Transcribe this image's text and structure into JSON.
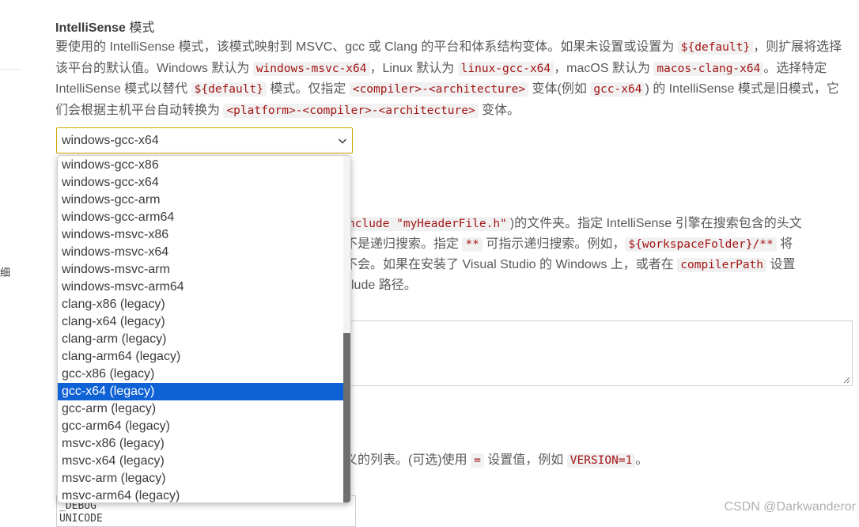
{
  "setting": {
    "title": "IntelliSense",
    "title_suffix": " 模式",
    "description": [
      {
        "t": "要使用的 IntelliSense 模式，该模式映射到 MSVC、gcc 或 Clang 的平台和体系结构变体。如果未设置或设置为 "
      },
      {
        "c": "${default}"
      },
      {
        "t": "，则扩展将选择该平台的默认值。Windows 默认为 "
      },
      {
        "c": "windows-msvc-x64"
      },
      {
        "t": "，Linux 默认为 "
      },
      {
        "c": "linux-gcc-x64"
      },
      {
        "t": "，macOS 默认为 "
      },
      {
        "c": "macos-clang-x64"
      },
      {
        "t": "。选择特定 IntelliSense 模式以替代 "
      },
      {
        "c": "${default}"
      },
      {
        "t": " 模式。仅指定 "
      },
      {
        "c": "<compiler>-<architecture>"
      },
      {
        "t": " 变体(例如 "
      },
      {
        "c": "gcc-x64"
      },
      {
        "t": ") 的 IntelliSense 模式是旧模式，它们会根据主机平台自动转换为 "
      },
      {
        "c": "<platform>-<compiler>-<architecture>"
      },
      {
        "t": " 变体。"
      }
    ]
  },
  "select": {
    "value": "windows-gcc-x64",
    "options": [
      "windows-gcc-x86",
      "windows-gcc-x64",
      "windows-gcc-arm",
      "windows-gcc-arm64",
      "windows-msvc-x86",
      "windows-msvc-x64",
      "windows-msvc-arm",
      "windows-msvc-arm64",
      "clang-x86 (legacy)",
      "clang-x64 (legacy)",
      "clang-arm (legacy)",
      "clang-arm64 (legacy)",
      "gcc-x86 (legacy)",
      "gcc-x64 (legacy)",
      "gcc-arm (legacy)",
      "gcc-arm64 (legacy)",
      "msvc-x86 (legacy)",
      "msvc-x64 (legacy)",
      "msvc-arm (legacy)",
      "msvc-arm64 (legacy)"
    ],
    "highlighted_index": 13
  },
  "include_path": {
    "line1": [
      {
        "c": "nclude \"myHeaderFile.h\""
      },
      {
        "t": ")的文件夹。指定 IntelliSense 引擎在搜索包含的头文"
      }
    ],
    "line2": [
      {
        "t": "不是递归搜索。指定 "
      },
      {
        "c": "**"
      },
      {
        "t": " 可指示递归搜索。例如，"
      },
      {
        "c": "${workspaceFolder}/**"
      },
      {
        "t": " 将"
      }
    ],
    "line3": [
      {
        "t": "不会。如果在安装了 Visual Studio 的 Windows 上，或者在 "
      },
      {
        "c": "compilerPath"
      },
      {
        "t": " 设置"
      }
    ],
    "line4": [
      {
        "t": "clude 路径。"
      }
    ]
  },
  "defines": {
    "desc": [
      {
        "t": "义的列表。(可选)使用 "
      },
      {
        "c": "="
      },
      {
        "t": " 设置值，例如 "
      },
      {
        "c": "VERSION=1"
      },
      {
        "t": "。"
      }
    ],
    "values": [
      "_DEBUG",
      "UNICODE"
    ]
  },
  "left_panel": {
    "glyph": "细"
  },
  "watermark": "CSDN @Darkwanderor",
  "colors": {
    "selection": "#0f62d6",
    "code_text": "#a31515",
    "focus_border": "#cfa700"
  }
}
